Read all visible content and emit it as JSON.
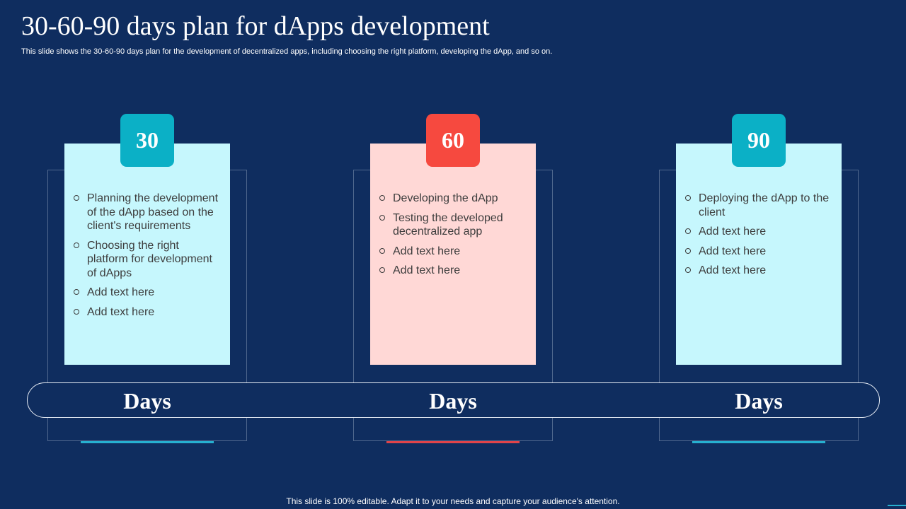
{
  "title": "30-60-90 days plan for dApps development",
  "subtitle": "This slide shows the 30-60-90 days plan for the development of decentralized apps, including choosing the right platform, developing the dApp,  and so on.",
  "footer": "This slide is 100% editable. Adapt it to your needs and capture your audience's attention.",
  "colors": {
    "background": "#0f2d5f",
    "teal_accent": "#0bb0c6",
    "red_accent": "#f6493f",
    "card_light_blue": "#c6f7fd",
    "card_light_pink": "#ffd8d6",
    "underline_teal": "#27b0d0",
    "underline_red": "#e0444a"
  },
  "plans": [
    {
      "number": "30",
      "days_label": "Days",
      "items": [
        "Planning the development of the dApp based on the client's requirements",
        "Choosing the right platform for development of dApps",
        "Add text here",
        "Add text here"
      ]
    },
    {
      "number": "60",
      "days_label": "Days",
      "items": [
        "Developing the dApp",
        "Testing the developed decentralized app",
        "Add text here",
        "Add text here"
      ]
    },
    {
      "number": "90",
      "days_label": "Days",
      "items": [
        "Deploying the dApp to the client",
        "Add text here",
        "Add text here",
        "Add text here"
      ]
    }
  ]
}
